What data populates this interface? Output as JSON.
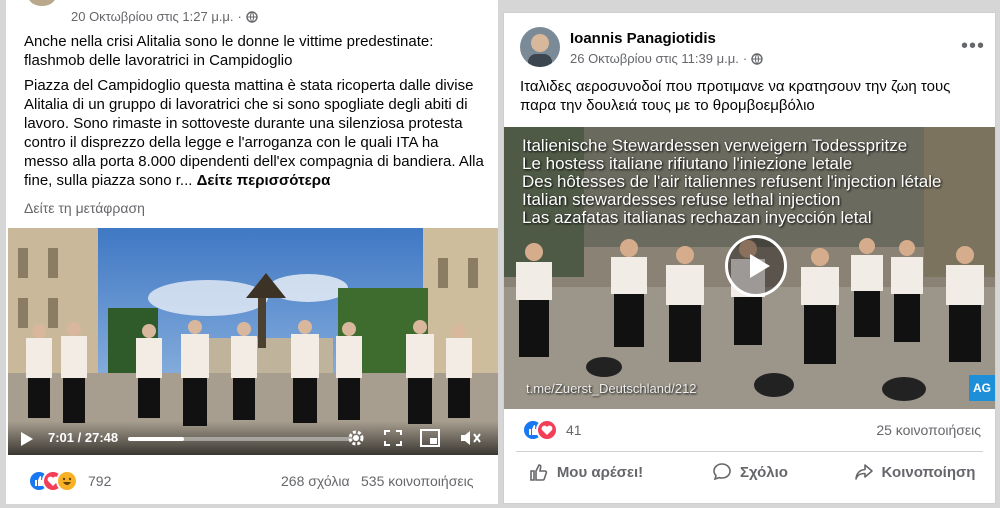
{
  "left_post": {
    "timestamp": "20 Οκτωβρίου στις 1:27 μ.μ.",
    "privacy_icon": "globe-icon",
    "headline": "Anche nella crisi Alitalia sono le donne le vittime predestinate: flashmob delle lavoratrici in Campidoglio",
    "body": "Piazza del Campidoglio questa mattina è stata ricoperta dalle divise Alitalia di un gruppo di lavoratrici che si sono spogliate degli abiti di lavoro. Sono rimaste in sottoveste durante una silenziosa protesta contro il disprezzo della legge e l'arroganza con le quali ITA ha messo alla porta 8.000 dipendenti dell'ex compagnia di bandiera. Alla fine, sulla piazza sono r...",
    "see_more": "Δείτε περισσότερα",
    "translate": "Δείτε τη μετάφραση",
    "video_time": "7:01 / 27:48",
    "video_progress": 0.25,
    "reactions": [
      "like-icon",
      "love-icon",
      "haha-icon"
    ],
    "reaction_count": "792",
    "comments": "268 σχόλια",
    "shares": "535 κοινοποιήσεις"
  },
  "right_post": {
    "author": "Ioannis Panagiotidis",
    "timestamp": "26 Οκτωβρίου στις 11:39 μ.μ.",
    "privacy_icon": "globe-icon",
    "text": "Ιταλιδες αεροσυνοδοί που προτιμανε να κρατησουν την ζωη τους παρα την δουλειά τους με το θρομβοεμβόλιο",
    "overlay_lines": [
      "Italienische Stewardessen verweigern Todesspritze",
      "Le hostess italiane rifiutano l'iniezione letale",
      "Des hôtesses de l'air italiennes refusent l'injection létale",
      "Italian stewardesses refuse lethal injection",
      "Las azafatas italianas rechazan inyección letal"
    ],
    "watermark": "t.me/Zuerst_Deutschland/212",
    "badge": "AG",
    "reactions": [
      "like-icon",
      "love-icon"
    ],
    "reaction_count": "41",
    "shares": "25 κοινοποιήσεις",
    "like_label": "Μου αρέσει!",
    "comment_label": "Σχόλιο",
    "share_label": "Κοινοποίηση"
  },
  "colors": {
    "facebook_blue": "#1877f2",
    "love": "#f33e58",
    "haha": "#f7b125"
  }
}
